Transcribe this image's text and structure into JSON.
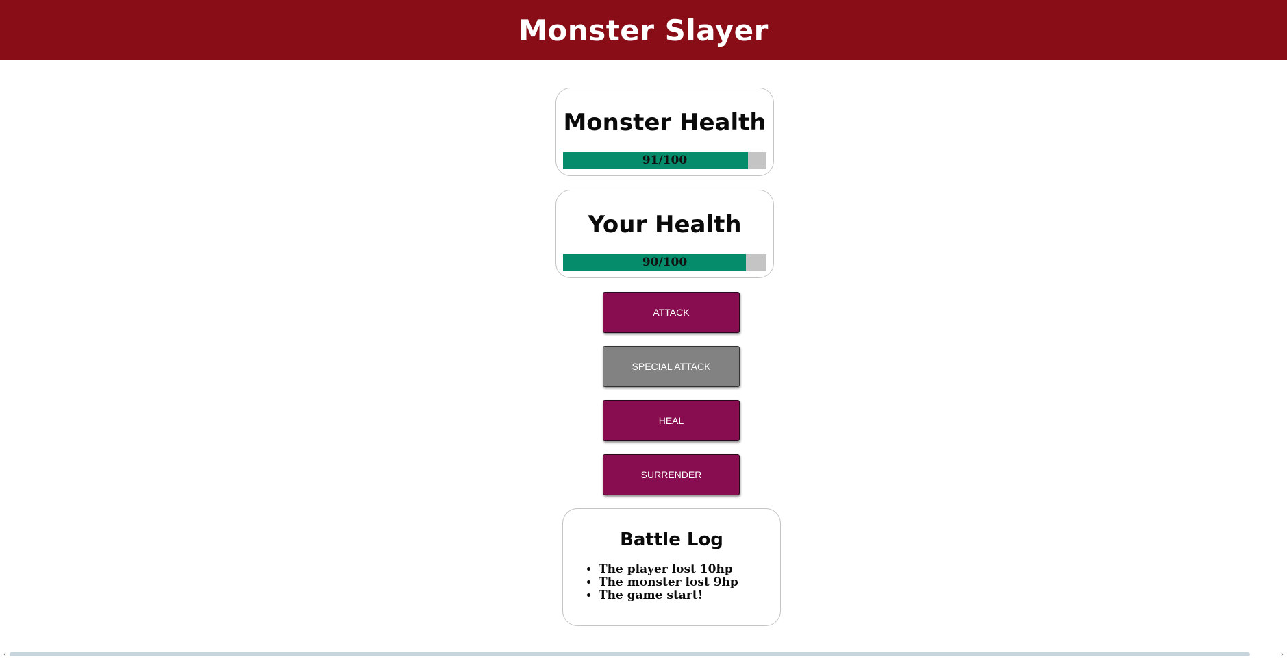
{
  "header": {
    "title": "Monster Slayer"
  },
  "monster": {
    "title": "Monster Health",
    "health": 91,
    "max": 100,
    "label": "91/100"
  },
  "player": {
    "title": "Your Health",
    "health": 90,
    "max": 100,
    "label": "90/100"
  },
  "actions": {
    "attack": "ATTACK",
    "special_attack": "SPECIAL ATTACK",
    "heal": "HEAL",
    "surrender": "SURRENDER",
    "special_attack_disabled": true
  },
  "log": {
    "title": "Battle Log",
    "entries": [
      "The player lost 10hp",
      "The monster lost 9hp",
      "The game start!"
    ]
  },
  "colors": {
    "header": "#880d17",
    "button": "#880d50",
    "button_disabled": "#828282",
    "health_fill": "#058c6a",
    "health_track": "#c4c4c4"
  },
  "icons": {
    "scroll_left": "chevron-left-icon",
    "scroll_right": "chevron-right-icon"
  }
}
